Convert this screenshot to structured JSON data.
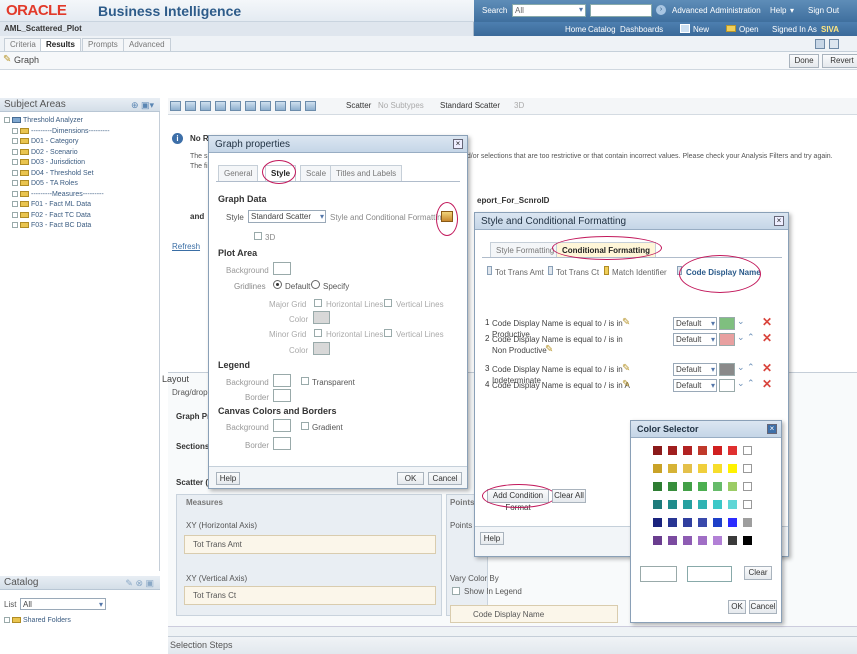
{
  "header": {
    "logo": "ORACLE",
    "product": "Business Intelligence",
    "search_label": "Search",
    "search_scope": "All",
    "advanced": "Advanced",
    "administration": "Administration",
    "help": "Help",
    "signout": "Sign Out"
  },
  "nav": {
    "analysis_name": "AML_Scattered_Plot",
    "home": "Home",
    "catalog": "Catalog",
    "dashboards": "Dashboards",
    "new": "New",
    "open": "Open",
    "signed_in": "Signed In As",
    "user": "SIVA"
  },
  "tabs": [
    "Criteria",
    "Results",
    "Prompts",
    "Advanced"
  ],
  "graph_bar": {
    "title": "Graph",
    "done": "Done",
    "revert": "Revert"
  },
  "subject_areas": {
    "title": "Subject Areas",
    "root": "Threshold Analyzer",
    "items": [
      "---------Dimensions---------",
      "D01 - Category",
      "D02 - Scenario",
      "D03 - Jurisdiction",
      "D04 - Threshold Set",
      "D05 - TA Roles",
      "---------Measures---------",
      "F01 - Fact ML Data",
      "F02 - Fact TC Data",
      "F03 - Fact BC Data"
    ]
  },
  "catalog": {
    "title": "Catalog",
    "list_label": "List",
    "list_value": "All",
    "shared": "Shared Folders"
  },
  "toolbar": {
    "scatter": "Scatter",
    "nosub": "No Subtypes",
    "standard": "Standard Scatter",
    "threed": "3D"
  },
  "message": {
    "title": "No Re",
    "line1": "The sp",
    "line2": "The filt",
    "right": "nd/or selections that are too restrictive or that contain incorrect values. Please check your Analysis Filters and try again."
  },
  "behind": {
    "report": "eport_For_ScnroID",
    "and": "and",
    "refresh": "Refresh",
    "layout": "Layout",
    "dragdrop": "Drag/drop",
    "graph_prompts": "Graph Pr",
    "sections": "Sections",
    "scatter": "Scatter (",
    "measures": "Measures",
    "x_axis": "XY (Horizontal Axis)",
    "x_measure": "Tot Trans Amt",
    "y_axis": "XY (Vertical Axis)",
    "y_measure": "Tot Trans Ct",
    "points": "Points",
    "points2": "Points",
    "vary": "Vary Color By",
    "show_legend": "Show In Legend",
    "code": "Code Display Name",
    "selection": "Selection Steps"
  },
  "graph_props": {
    "title": "Graph properties",
    "tabs": [
      "General",
      "Style",
      "Scale",
      "Titles and Labels"
    ],
    "graph_data": "Graph Data",
    "style_label": "Style",
    "style_value": "Standard Scatter",
    "style_cf": "Style and Conditional Formatting",
    "threed": "3D",
    "plot_area": "Plot Area",
    "background": "Background",
    "gridlines": "Gridlines",
    "default": "Default",
    "specify": "Specify",
    "major": "Major Grid",
    "minor": "Minor Grid",
    "hlines": "Horizontal Lines",
    "vlines": "Vertical Lines",
    "color": "Color",
    "legend": "Legend",
    "transparent": "Transparent",
    "border": "Border",
    "canvas": "Canvas Colors and Borders",
    "gradient": "Gradient",
    "help": "Help",
    "ok": "OK",
    "cancel": "Cancel"
  },
  "scf": {
    "title": "Style and Conditional Formatting",
    "tabs": [
      "Style Formatting",
      "Conditional Formatting"
    ],
    "cols": [
      "Tot Trans Amt",
      "Tot Trans Ct",
      "Match Identifier",
      "Code Display Name"
    ],
    "rules": [
      {
        "n": "1",
        "text": "Code Display Name is equal to / is in Productive",
        "v": "Default",
        "c": "#7fbf7f"
      },
      {
        "n": "2",
        "text": "Code Display Name is equal to / is in Non Productive",
        "v": "Default",
        "c": "#e8a0a0"
      },
      {
        "n": "3",
        "text": "Code Display Name is equal to / is in Indeterminate",
        "v": "Default",
        "c": "#8a8a8a"
      },
      {
        "n": "4",
        "text": "Code Display Name is equal to / is in A",
        "v": "Default",
        "c": "#ffffff"
      }
    ],
    "add": "Add Condition Format",
    "clear": "Clear All",
    "help": "Help"
  },
  "color_selector": {
    "title": "Color Selector",
    "clear": "Clear",
    "ok": "OK",
    "cancel": "Cancel",
    "rows": [
      [
        "#8b1a1a",
        "#a01e1e",
        "#b22222",
        "#c0392b",
        "#d02020",
        "#e03030",
        "#ffffff"
      ],
      [
        "#c9a227",
        "#d6b336",
        "#e4c04a",
        "#f0cf3c",
        "#f7dd2c",
        "#fff200",
        "#ffffff"
      ],
      [
        "#2e7d32",
        "#388e3c",
        "#43a047",
        "#4caf50",
        "#66bb6a",
        "#9ccc65",
        "#ffffff"
      ],
      [
        "#1e7b7b",
        "#208c8c",
        "#26a0a0",
        "#2fb3b3",
        "#3cc8c8",
        "#5fd6d6",
        "#ffffff"
      ],
      [
        "#1a237e",
        "#283593",
        "#303f9f",
        "#3949ab",
        "#1e40c8",
        "#2c2cff",
        "#9e9e9e"
      ],
      [
        "#6a3d8f",
        "#7b4ba0",
        "#8e5cb3",
        "#a06ec5",
        "#b280d6",
        "#3a3a3a",
        "#000000"
      ]
    ]
  }
}
